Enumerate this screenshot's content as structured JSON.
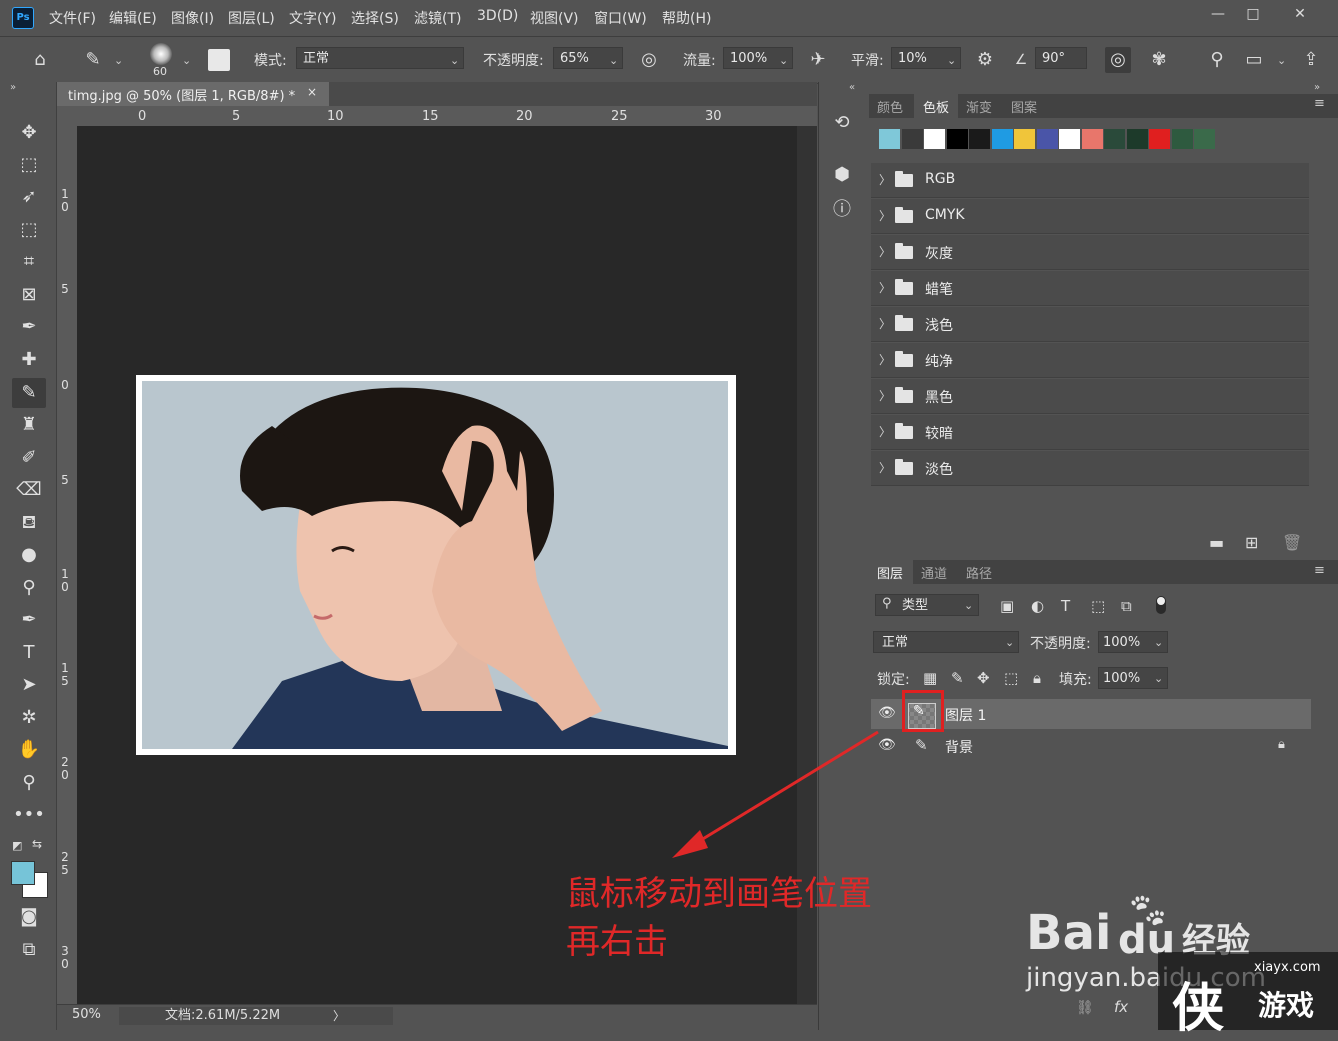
{
  "app": {
    "logo_text": "Ps"
  },
  "menu": [
    "文件(F)",
    "编辑(E)",
    "图像(I)",
    "图层(L)",
    "文字(Y)",
    "选择(S)",
    "滤镜(T)",
    "3D(D)",
    "视图(V)",
    "窗口(W)",
    "帮助(H)"
  ],
  "window_controls": {
    "minimize": "—",
    "restore": "□",
    "close": "✕"
  },
  "options": {
    "brush_size": "60",
    "mode_label": "模式:",
    "mode_value": "正常",
    "opacity_label": "不透明度:",
    "opacity_value": "65%",
    "flow_label": "流量:",
    "flow_value": "100%",
    "smooth_label": "平滑:",
    "smooth_value": "10%",
    "angle_value": "90°"
  },
  "document": {
    "tab_title": "timg.jpg @ 50% (图层 1, RGB/8#) *",
    "tab_close": "×",
    "hruler": [
      "0",
      "5",
      "10",
      "15",
      "20",
      "25",
      "30"
    ],
    "vruler": [
      "1\n0",
      "5",
      "0",
      "5",
      "1\n0",
      "1\n5",
      "2\n0",
      "2\n5",
      "3\n0"
    ]
  },
  "status": {
    "zoom": "50%",
    "doc_info": "文档:2.61M/5.22M",
    "arrow": "〉"
  },
  "swatches_panel": {
    "tabs": [
      "颜色",
      "色板",
      "渐变",
      "图案"
    ],
    "colors": [
      "#7fc8d9",
      "#3a3a3a",
      "#ffffff",
      "#000000",
      "#1a1a1a",
      "#1f9be3",
      "#f0c53a",
      "#4a55a8",
      "#ffffff",
      "#e8766b",
      "#2a4a3a",
      "#1d3a2a",
      "#e01f1f",
      "#2e5a3f",
      "#3a6a4a"
    ],
    "folders": [
      "RGB",
      "CMYK",
      "灰度",
      "蜡笔",
      "浅色",
      "纯净",
      "黑色",
      "较暗",
      "淡色"
    ]
  },
  "layers_panel": {
    "tabs": [
      "图层",
      "通道",
      "路径"
    ],
    "filter_label": "类型",
    "blend_mode": "正常",
    "opacity_label": "不透明度:",
    "opacity_value": "100%",
    "lock_label": "锁定:",
    "fill_label": "填充:",
    "fill_value": "100%",
    "layers": [
      {
        "name": "图层 1",
        "selected": true
      },
      {
        "name": "背景",
        "locked": true
      }
    ]
  },
  "annotation": {
    "line1": "鼠标移动到画笔位置",
    "line2": "再右击",
    "color": "#e02828"
  },
  "watermark": {
    "baidu": "Bai",
    "du": "du",
    "jingyan": "经验",
    "url": "jingyan.baidu.com",
    "site": "xiayx.com",
    "game": "游戏"
  },
  "colors": {
    "foreground": "#76c4d8",
    "background": "#ffffff"
  }
}
